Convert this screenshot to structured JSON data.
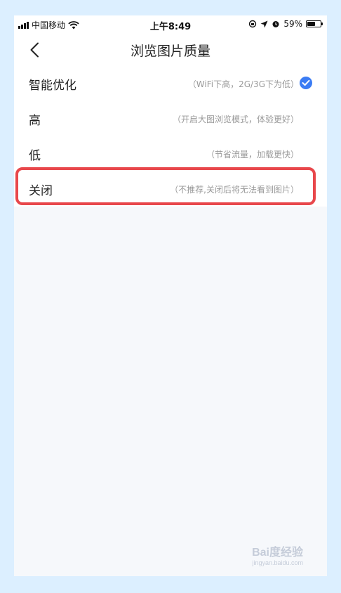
{
  "status_bar": {
    "carrier": "中国移动",
    "time": "上午8:49",
    "battery": "59%",
    "battery_level": 0.59
  },
  "nav": {
    "title": "浏览图片质量"
  },
  "options": [
    {
      "label": "智能优化",
      "desc": "（WiFi下高，2G/3G下为低）",
      "selected": true
    },
    {
      "label": "高",
      "desc": "（开启大图浏览模式，体验更好）",
      "selected": false
    },
    {
      "label": "低",
      "desc": "（节省流量，加载更快）",
      "selected": false
    },
    {
      "label": "关闭",
      "desc": "（不推荐,关闭后将无法看到图片）",
      "selected": false
    }
  ],
  "watermark": {
    "text": "Bai度经验",
    "sub": "jingyan.baidu.com"
  },
  "colors": {
    "accent": "#3b7cf4",
    "highlight": "#e8474b",
    "background": "#dcefff"
  }
}
